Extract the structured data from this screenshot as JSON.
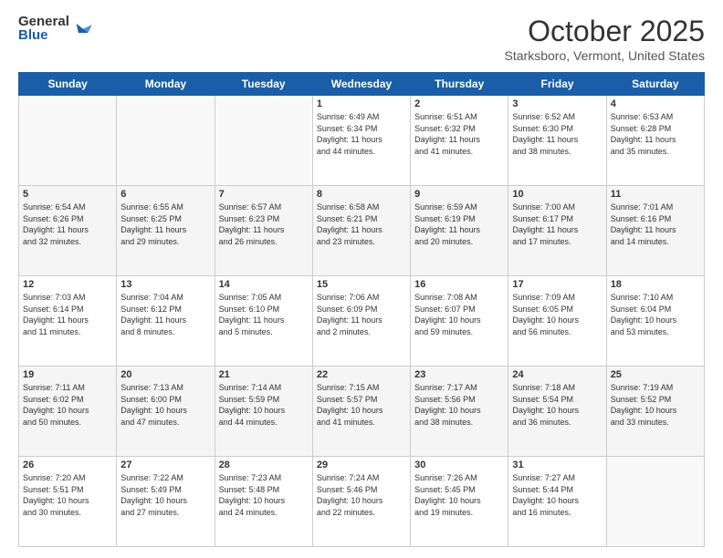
{
  "logo": {
    "general": "General",
    "blue": "Blue"
  },
  "title": "October 2025",
  "location": "Starksboro, Vermont, United States",
  "days_of_week": [
    "Sunday",
    "Monday",
    "Tuesday",
    "Wednesday",
    "Thursday",
    "Friday",
    "Saturday"
  ],
  "weeks": [
    [
      {
        "day": "",
        "info": ""
      },
      {
        "day": "",
        "info": ""
      },
      {
        "day": "",
        "info": ""
      },
      {
        "day": "1",
        "info": "Sunrise: 6:49 AM\nSunset: 6:34 PM\nDaylight: 11 hours\nand 44 minutes."
      },
      {
        "day": "2",
        "info": "Sunrise: 6:51 AM\nSunset: 6:32 PM\nDaylight: 11 hours\nand 41 minutes."
      },
      {
        "day": "3",
        "info": "Sunrise: 6:52 AM\nSunset: 6:30 PM\nDaylight: 11 hours\nand 38 minutes."
      },
      {
        "day": "4",
        "info": "Sunrise: 6:53 AM\nSunset: 6:28 PM\nDaylight: 11 hours\nand 35 minutes."
      }
    ],
    [
      {
        "day": "5",
        "info": "Sunrise: 6:54 AM\nSunset: 6:26 PM\nDaylight: 11 hours\nand 32 minutes."
      },
      {
        "day": "6",
        "info": "Sunrise: 6:55 AM\nSunset: 6:25 PM\nDaylight: 11 hours\nand 29 minutes."
      },
      {
        "day": "7",
        "info": "Sunrise: 6:57 AM\nSunset: 6:23 PM\nDaylight: 11 hours\nand 26 minutes."
      },
      {
        "day": "8",
        "info": "Sunrise: 6:58 AM\nSunset: 6:21 PM\nDaylight: 11 hours\nand 23 minutes."
      },
      {
        "day": "9",
        "info": "Sunrise: 6:59 AM\nSunset: 6:19 PM\nDaylight: 11 hours\nand 20 minutes."
      },
      {
        "day": "10",
        "info": "Sunrise: 7:00 AM\nSunset: 6:17 PM\nDaylight: 11 hours\nand 17 minutes."
      },
      {
        "day": "11",
        "info": "Sunrise: 7:01 AM\nSunset: 6:16 PM\nDaylight: 11 hours\nand 14 minutes."
      }
    ],
    [
      {
        "day": "12",
        "info": "Sunrise: 7:03 AM\nSunset: 6:14 PM\nDaylight: 11 hours\nand 11 minutes."
      },
      {
        "day": "13",
        "info": "Sunrise: 7:04 AM\nSunset: 6:12 PM\nDaylight: 11 hours\nand 8 minutes."
      },
      {
        "day": "14",
        "info": "Sunrise: 7:05 AM\nSunset: 6:10 PM\nDaylight: 11 hours\nand 5 minutes."
      },
      {
        "day": "15",
        "info": "Sunrise: 7:06 AM\nSunset: 6:09 PM\nDaylight: 11 hours\nand 2 minutes."
      },
      {
        "day": "16",
        "info": "Sunrise: 7:08 AM\nSunset: 6:07 PM\nDaylight: 10 hours\nand 59 minutes."
      },
      {
        "day": "17",
        "info": "Sunrise: 7:09 AM\nSunset: 6:05 PM\nDaylight: 10 hours\nand 56 minutes."
      },
      {
        "day": "18",
        "info": "Sunrise: 7:10 AM\nSunset: 6:04 PM\nDaylight: 10 hours\nand 53 minutes."
      }
    ],
    [
      {
        "day": "19",
        "info": "Sunrise: 7:11 AM\nSunset: 6:02 PM\nDaylight: 10 hours\nand 50 minutes."
      },
      {
        "day": "20",
        "info": "Sunrise: 7:13 AM\nSunset: 6:00 PM\nDaylight: 10 hours\nand 47 minutes."
      },
      {
        "day": "21",
        "info": "Sunrise: 7:14 AM\nSunset: 5:59 PM\nDaylight: 10 hours\nand 44 minutes."
      },
      {
        "day": "22",
        "info": "Sunrise: 7:15 AM\nSunset: 5:57 PM\nDaylight: 10 hours\nand 41 minutes."
      },
      {
        "day": "23",
        "info": "Sunrise: 7:17 AM\nSunset: 5:56 PM\nDaylight: 10 hours\nand 38 minutes."
      },
      {
        "day": "24",
        "info": "Sunrise: 7:18 AM\nSunset: 5:54 PM\nDaylight: 10 hours\nand 36 minutes."
      },
      {
        "day": "25",
        "info": "Sunrise: 7:19 AM\nSunset: 5:52 PM\nDaylight: 10 hours\nand 33 minutes."
      }
    ],
    [
      {
        "day": "26",
        "info": "Sunrise: 7:20 AM\nSunset: 5:51 PM\nDaylight: 10 hours\nand 30 minutes."
      },
      {
        "day": "27",
        "info": "Sunrise: 7:22 AM\nSunset: 5:49 PM\nDaylight: 10 hours\nand 27 minutes."
      },
      {
        "day": "28",
        "info": "Sunrise: 7:23 AM\nSunset: 5:48 PM\nDaylight: 10 hours\nand 24 minutes."
      },
      {
        "day": "29",
        "info": "Sunrise: 7:24 AM\nSunset: 5:46 PM\nDaylight: 10 hours\nand 22 minutes."
      },
      {
        "day": "30",
        "info": "Sunrise: 7:26 AM\nSunset: 5:45 PM\nDaylight: 10 hours\nand 19 minutes."
      },
      {
        "day": "31",
        "info": "Sunrise: 7:27 AM\nSunset: 5:44 PM\nDaylight: 10 hours\nand 16 minutes."
      },
      {
        "day": "",
        "info": ""
      }
    ]
  ]
}
